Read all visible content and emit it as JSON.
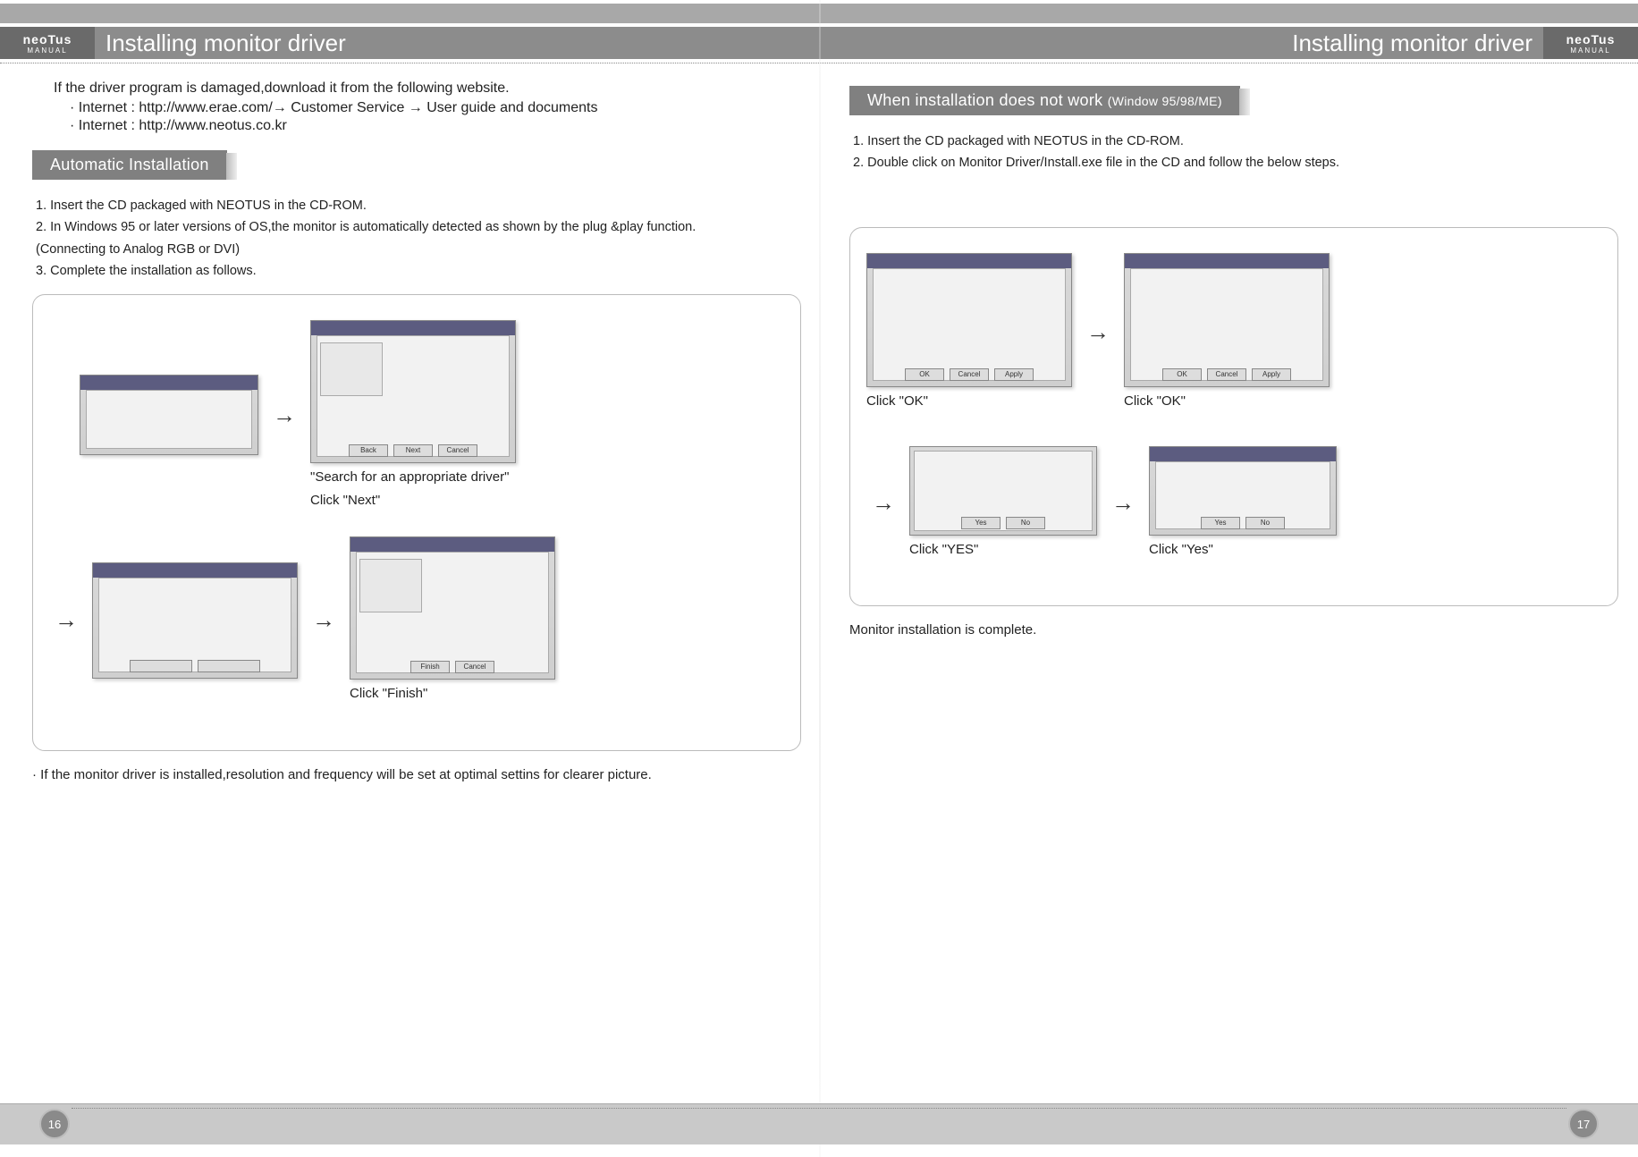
{
  "header": {
    "brand_top": "neoTus",
    "brand_bot": "MANUAL",
    "title_left": "Installing monitor driver",
    "title_right": "Installing monitor driver"
  },
  "left": {
    "intro": "If the driver program is damaged,download it from the following website.",
    "b1": "·   Internet : http://www.erae.com/→ Customer Service → User guide and documents",
    "b2": "·   Internet : http://www.neotus.co.kr",
    "section": "Automatic Installation",
    "s1": "1. Insert the CD packaged with NEOTUS in the CD-ROM.",
    "s2": "2. In Windows 95 or later versions of OS,the monitor is automatically detected as shown by the plug &play function.",
    "s2b": "   (Connecting to Analog RGB or DVI)",
    "s3": "3. Complete the installation as follows.",
    "cap1a": "\"Search for an appropriate driver\"",
    "cap1b": "Click \"Next\"",
    "cap2": "Click \"Finish\"",
    "note": "·  If the monitor driver is installed,resolution and frequency will be set at optimal settins for clearer picture."
  },
  "right": {
    "section_main": "When installation does not work",
    "section_sub": "(Window 95/98/ME)",
    "s1": "1. Insert the CD packaged with NEOTUS in the CD-ROM.",
    "s2": "2. Double click on Monitor Driver/Install.exe file in the CD and follow the below steps.",
    "cap_ok": "Click \"OK\"",
    "cap_yes_upper": "Click \"YES\"",
    "cap_yes": "Click \"Yes\"",
    "done": "Monitor installation is complete."
  },
  "dlg": {
    "ok": "OK",
    "cancel": "Cancel",
    "apply": "Apply",
    "next": "Next",
    "back": "Back",
    "finish": "Finish",
    "yes": "Yes",
    "no": "No"
  },
  "footer": {
    "pg_left": "16",
    "pg_right": "17"
  }
}
